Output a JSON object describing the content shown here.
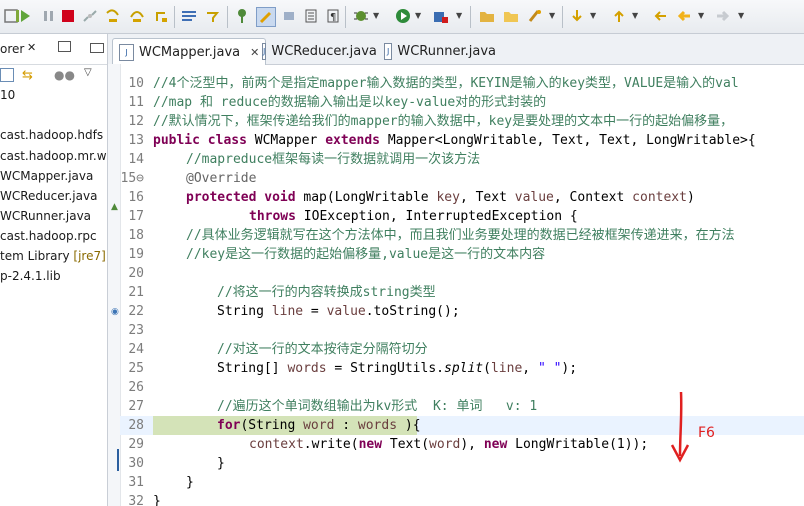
{
  "toolbar": {
    "icons": [
      "skip-breakpoints-icon",
      "resume-icon",
      "suspend-icon",
      "terminate-icon",
      "disconnect-icon",
      "step-into-icon",
      "step-over-icon",
      "step-return-icon",
      "drop-to-frame-icon",
      "use-step-filters-icon",
      "toggle-breakpoint-icon",
      "mark-occurrences-icon",
      "show-whitespace-icon",
      "block-selection-icon",
      "paragraph-icon",
      "debug-icon",
      "run-icon",
      "external-tools-icon",
      "open-type-icon",
      "open-task-icon",
      "search-icon",
      "next-annotation-icon",
      "previous-annotation-icon",
      "last-edit-icon",
      "back-icon",
      "forward-icon"
    ]
  },
  "explorer": {
    "tab_label": "orer",
    "items": [
      "10",
      "cast.hadoop.hdfs",
      "cast.hadoop.mr.w",
      "WCMapper.java",
      "WCReducer.java",
      "WCRunner.java",
      "cast.hadoop.rpc",
      "tem Library",
      "[jre7]",
      "p-2.4.1.lib"
    ]
  },
  "tabs": [
    {
      "label": "WCMapper.java",
      "close": "✕"
    },
    {
      "label": "WCReducer.java"
    },
    {
      "label": "WCRunner.java"
    }
  ],
  "code_lines": [
    {
      "num": "10"
    },
    {
      "num": "11"
    },
    {
      "num": "12"
    },
    {
      "num": "13"
    },
    {
      "num": "14"
    },
    {
      "num": "15⊖"
    },
    {
      "num": "16"
    },
    {
      "num": "17"
    },
    {
      "num": "18"
    },
    {
      "num": "19"
    },
    {
      "num": "20"
    },
    {
      "num": "21"
    },
    {
      "num": "22"
    },
    {
      "num": "23"
    },
    {
      "num": "24"
    },
    {
      "num": "25"
    },
    {
      "num": "26"
    },
    {
      "num": "27"
    },
    {
      "num": "28"
    },
    {
      "num": "29"
    },
    {
      "num": "30"
    },
    {
      "num": "31"
    },
    {
      "num": "32"
    }
  ],
  "code": {
    "l10": "//4个泛型中，前两个是指定mapper输入数据的类型，KEYIN是输入的key类型，VALUE是输入的val",
    "l11": "//map 和 reduce的数据输入输出是以key-value对的形式封装的",
    "l12": "//默认情况下，框架传递给我们的mapper的输入数据中，key是要处理的文本中一行的起始偏移量，",
    "l13_kw1": "public class",
    "l13_a": " WCMapper ",
    "l13_kw2": "extends",
    "l13_b": " Mapper<LongWritable, Text, Text, LongWritable>{",
    "l14": "//mapreduce框架每读一行数据就调用一次该方法",
    "l15": "@Override",
    "l16_kw": "protected void",
    "l16_a": " map(LongWritable ",
    "l16_v1": "key",
    "l16_b": ", Text ",
    "l16_v2": "value",
    "l16_c": ", Context ",
    "l16_v3": "context",
    "l16_d": ")",
    "l17_kw": "throws",
    "l17_a": " IOException, InterruptedException {",
    "l18": "//具体业务逻辑就写在这个方法体中，而且我们业务要处理的数据已经被框架传递进来，在方法",
    "l19": "//key是这一行数据的起始偏移量,value是这一行的文本内容",
    "l21": "//将这一行的内容转换成string类型",
    "l22_a": "String ",
    "l22_v": "line",
    "l22_b": " = ",
    "l22_v2": "value",
    "l22_c": ".toString();",
    "l24": "//对这一行的文本按待定分隔符切分",
    "l25_a": "String[] ",
    "l25_v": "words",
    "l25_b": " = StringUtils.",
    "l25_it": "split",
    "l25_c": "(",
    "l25_v2": "line",
    "l25_d": ", ",
    "l25_s": "\" \"",
    "l25_e": ");",
    "l27": "//遍历这个单词数组输出为kv形式  K: 单词   v: 1",
    "l28_kw": "for",
    "l28_a": "(String ",
    "l28_v": "word",
    "l28_b": " : ",
    "l28_v2": "words",
    "l28_c": " ){",
    "l29_v": "context",
    "l29_a": ".write(",
    "l29_kw1": "new",
    "l29_b": " Text(",
    "l29_v2": "word",
    "l29_c": "), ",
    "l29_kw2": "new",
    "l29_d": " LongWritable(1));",
    "l30": "}",
    "l31": "}",
    "l32": "}"
  },
  "annotation": {
    "label": "F6",
    "color": "#e02020"
  }
}
